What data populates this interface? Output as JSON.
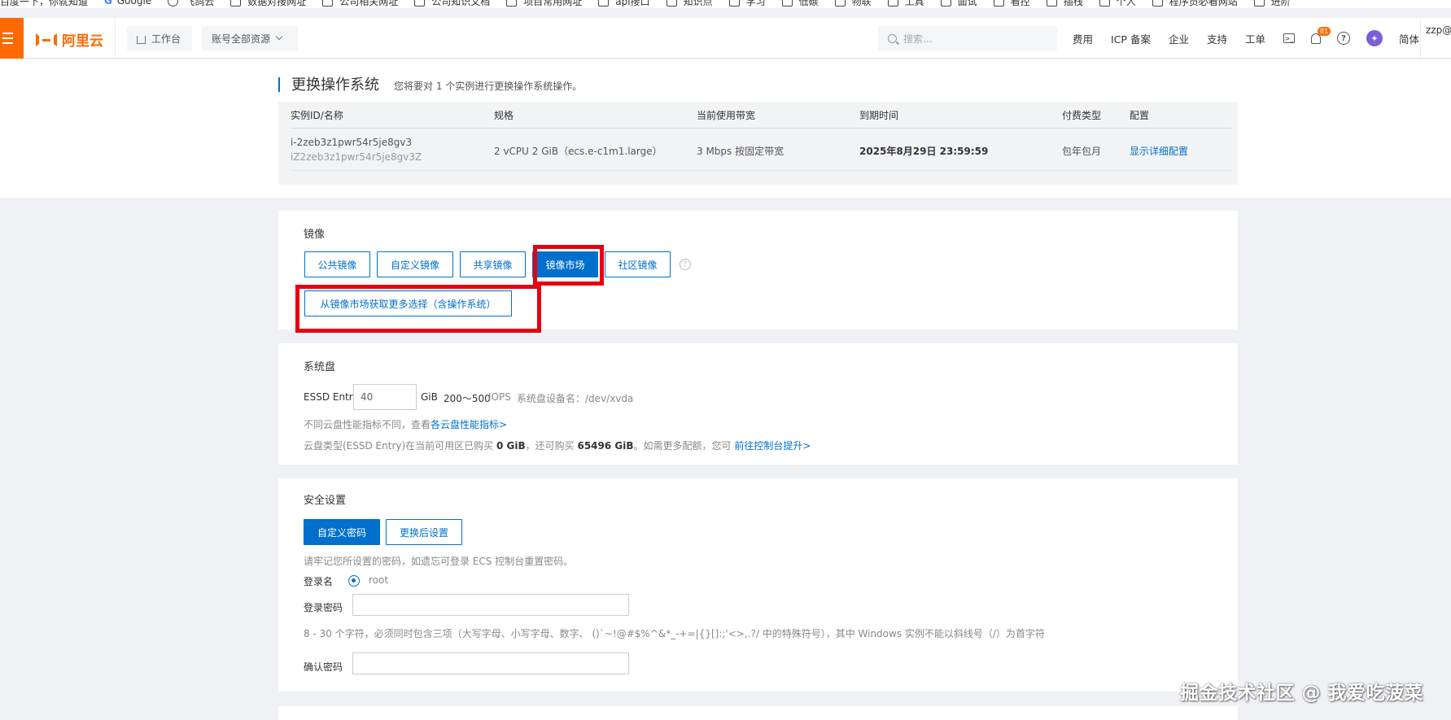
{
  "bookmarks": [
    "百度一下，你就知道",
    "Google",
    "飞鸽云",
    "数据对接网址",
    "公司相关网址",
    "公司知识文档",
    "项目常用网址",
    "api接口",
    "知识点",
    "学习",
    "低碳",
    "物联",
    "工具",
    "面试",
    "看控",
    "插栈",
    "个人",
    "程序员必看网站",
    "进阶"
  ],
  "nav": {
    "brand": "阿里云",
    "workbench": "工作台",
    "account_scope": "账号全部资源",
    "search_placeholder": "搜索...",
    "links": [
      "费用",
      "ICP 备案",
      "企业",
      "支持",
      "工单"
    ],
    "bell_badge": "81",
    "lang": "简体",
    "user": "zzp@"
  },
  "page": {
    "title": "更换操作系统",
    "subtitle": "您将要对 1 个实例进行更换操作系统操作。"
  },
  "instance_table": {
    "headers": [
      "实例ID/名称",
      "规格",
      "当前使用带宽",
      "到期时间",
      "付费类型",
      "配置"
    ],
    "row": {
      "id": "i-2zeb3z1pwr54r5je8gv3",
      "name": "iZ2zeb3z1pwr54r5je8gv3Z",
      "spec": "2 vCPU 2 GiB（ecs.e-c1m1.large）",
      "bandwidth": "3 Mbps 按固定带宽",
      "expire": "2025年8月29日 23:59:59",
      "billing": "包年包月",
      "config_link": "显示详细配置"
    }
  },
  "image_section": {
    "title": "镜像",
    "tabs": [
      "公共镜像",
      "自定义镜像",
      "共享镜像",
      "镜像市场",
      "社区镜像"
    ],
    "active_tab": "镜像市场",
    "help": "?",
    "market_button": "从镜像市场获取更多选择（含操作系统）"
  },
  "disk_section": {
    "title": "系统盘",
    "disk_type": "ESSD Entry",
    "size": "40",
    "unit": "GiB",
    "iops": "200～500",
    "iops_label": "IOPS",
    "device_label": "系统盘设备名：/dev/xvda",
    "perf_note": "不同云盘性能指标不同，查看",
    "perf_link": "各云盘性能指标>",
    "quota_note_1": "云盘类型(ESSD Entry)在当前可用区已购买",
    "quota_bought": "0 GiB",
    "quota_note_2": "，还可购买",
    "quota_left": "65496 GiB",
    "quota_note_3": "。如需更多配额，您可",
    "quota_link": "前往控制台提升>"
  },
  "security_section": {
    "title": "安全设置",
    "options": [
      "自定义密码",
      "更换后设置"
    ],
    "active_option": "自定义密码",
    "hint": "请牢记您所设置的密码，如遗忘可登录 ECS 控制台重置密码。",
    "login_name_label": "登录名",
    "login_name_value": "root",
    "password_label": "登录密码",
    "password_rule": "8 - 30 个字符，必须同时包含三项（大写字母、小写字母、数字、 ()`~!@#$%^&*_-+=|{}[]:;'<>,.?/ 中的特殊符号），其中 Windows 实例不能以斜线号（/）为首字符",
    "confirm_label": "确认密码"
  },
  "watermark": "掘金技术社区 @ 我爱吃菠菜",
  "colors": {
    "brand_orange": "#ff6a00",
    "primary_blue": "#0070cc",
    "highlight_red": "#e60012"
  }
}
